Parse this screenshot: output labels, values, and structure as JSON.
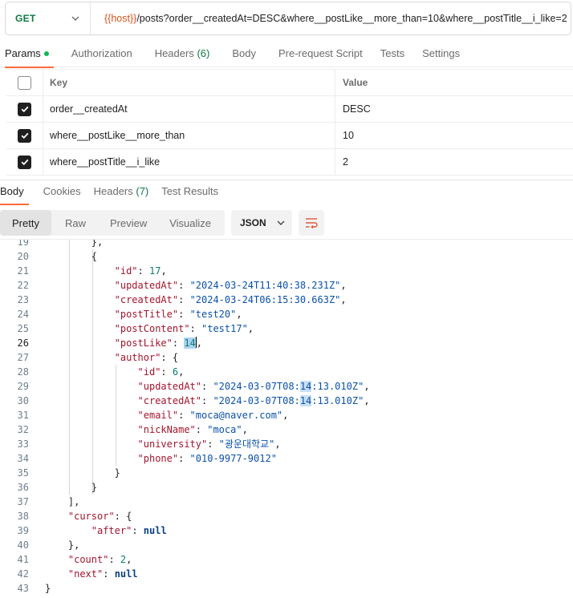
{
  "request": {
    "method": "GET",
    "url_variable": "{{host}}",
    "url_rest": "/posts?order__createdAt=DESC&where__postLike__more_than=10&where__postTitle__i_like=2"
  },
  "request_tabs": {
    "params": "Params",
    "authorization": "Authorization",
    "headers": "Headers",
    "headers_count": "(6)",
    "body": "Body",
    "prerequest": "Pre-request Script",
    "tests": "Tests",
    "settings": "Settings"
  },
  "params_table": {
    "key_header": "Key",
    "value_header": "Value",
    "rows": [
      {
        "key": "order__createdAt",
        "value": "DESC",
        "checked": true
      },
      {
        "key": "where__postLike__more_than",
        "value": "10",
        "checked": true
      },
      {
        "key": "where__postTitle__i_like",
        "value": "2",
        "checked": true
      }
    ]
  },
  "response_tabs": {
    "body": "Body",
    "cookies": "Cookies",
    "headers": "Headers",
    "headers_count": "(7)",
    "test_results": "Test Results"
  },
  "view_modes": {
    "pretty": "Pretty",
    "raw": "Raw",
    "preview": "Preview",
    "visualize": "Visualize"
  },
  "format": "JSON",
  "code_lines": [
    {
      "n": "19",
      "text": "},"
    },
    {
      "n": "20",
      "text": "{"
    },
    {
      "n": "21",
      "key": "\"id\"",
      "val": "17",
      "vt": "n",
      "trail": ","
    },
    {
      "n": "22",
      "key": "\"updatedAt\"",
      "val": "\"2024-03-24T11:40:38.231Z\"",
      "vt": "s",
      "trail": ","
    },
    {
      "n": "23",
      "key": "\"createdAt\"",
      "val": "\"2024-03-24T06:15:30.663Z\"",
      "vt": "s",
      "trail": ","
    },
    {
      "n": "24",
      "key": "\"postTitle\"",
      "val": "\"test20\"",
      "vt": "s",
      "trail": ","
    },
    {
      "n": "25",
      "key": "\"postContent\"",
      "val": "\"test17\"",
      "vt": "s",
      "trail": ","
    },
    {
      "n": "26",
      "key": "\"postLike\"",
      "val": "14",
      "vt": "n",
      "trail": ","
    },
    {
      "n": "27",
      "key": "\"author\"",
      "val": "{",
      "vt": "p",
      "trail": ""
    },
    {
      "n": "28",
      "key": "\"id\"",
      "val": "6",
      "vt": "n",
      "trail": ","
    },
    {
      "n": "29",
      "key": "\"updatedAt\"",
      "val_a": "\"2024-03-07T08:",
      "val_hl": "14",
      "val_b": ":13.010Z\"",
      "vt": "s",
      "trail": ","
    },
    {
      "n": "30",
      "key": "\"createdAt\"",
      "val_a": "\"2024-03-07T08:",
      "val_hl": "14",
      "val_b": ":13.010Z\"",
      "vt": "s",
      "trail": ","
    },
    {
      "n": "31",
      "key": "\"email\"",
      "val": "\"moca@naver.com\"",
      "vt": "s",
      "trail": ","
    },
    {
      "n": "32",
      "key": "\"nickName\"",
      "val": "\"moca\"",
      "vt": "s",
      "trail": ","
    },
    {
      "n": "33",
      "key": "\"university\"",
      "val": "\"광운대학교\"",
      "vt": "s",
      "trail": ","
    },
    {
      "n": "34",
      "key": "\"phone\"",
      "val": "\"010-9977-9012\"",
      "vt": "s",
      "trail": ""
    },
    {
      "n": "35",
      "text": "}"
    },
    {
      "n": "36",
      "text": "}"
    },
    {
      "n": "37",
      "text": "],"
    },
    {
      "n": "38",
      "key": "\"cursor\"",
      "val": "{",
      "vt": "p",
      "trail": ""
    },
    {
      "n": "39",
      "key": "\"after\"",
      "val": "null",
      "vt": "nul",
      "trail": ""
    },
    {
      "n": "40",
      "text": "},"
    },
    {
      "n": "41",
      "key": "\"count\"",
      "val": "2",
      "vt": "n",
      "trail": ","
    },
    {
      "n": "42",
      "key": "\"next\"",
      "val": "null",
      "vt": "nul",
      "trail": ""
    },
    {
      "n": "43",
      "text": "}"
    }
  ]
}
